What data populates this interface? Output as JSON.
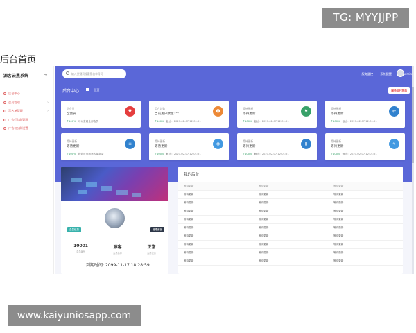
{
  "overlay": {
    "tg_badge": "TG: MYYJJPP",
    "page_caption": "后台首页",
    "url_badge": "www.kaiyuniosapp.com"
  },
  "sidebar": {
    "brand": "源客云黑系统",
    "items": [
      {
        "label": "后台中心",
        "has_arrow": false
      },
      {
        "label": "会员管理",
        "has_arrow": true
      },
      {
        "label": "黑名单管理",
        "has_arrow": true
      },
      {
        "label": "广告(顶部)管理",
        "has_arrow": false
      },
      {
        "label": "广告(底部)设置",
        "has_arrow": false
      }
    ]
  },
  "topbar": {
    "search_placeholder": "输入关键词搜索黑名单号码",
    "links": [
      "服务监控",
      "系统配置"
    ],
    "user_name": "admin"
  },
  "breadcrumb": {
    "title": "后台中心",
    "home": "首页"
  },
  "red_button": "服务运行状态",
  "cards": [
    {
      "label": "总会员",
      "value": "全会员",
      "up": "↑100%",
      "foot": "可以查看全部会员",
      "icon": "heart-icon",
      "glyph": "♥",
      "color": "#e53e3e"
    },
    {
      "label": "用户总数",
      "value": "当前用户数量1个",
      "up": "↑100%",
      "foot": "截止：2021-02-07 12:01:51",
      "icon": "user-icon",
      "glyph": "☻",
      "color": "#ed8936"
    },
    {
      "label": "等待更新",
      "value": "等待更新",
      "up": "↑100%",
      "foot": "截止：2021-02-07 12:01:51",
      "icon": "flag-icon",
      "glyph": "⚑",
      "color": "#38a169"
    },
    {
      "label": "等待更新",
      "value": "等待更新",
      "up": "↑100%",
      "foot": "截止：2021-02-07 12:01:51",
      "icon": "link-icon",
      "glyph": "⇄",
      "color": "#3182ce"
    },
    {
      "label": "等待更新",
      "value": "等待更新",
      "up": "↑100%",
      "foot": "此处可查看黑名单数量",
      "icon": "list-icon",
      "glyph": "≡",
      "color": "#3182ce"
    },
    {
      "label": "等待更新",
      "value": "等待更新",
      "up": "↑100%",
      "foot": "截止：2021-02-07 12:01:51",
      "icon": "compass-icon",
      "glyph": "◉",
      "color": "#4299e1"
    },
    {
      "label": "等待更新",
      "value": "等待更新",
      "up": "↑100%",
      "foot": "截止：2021-02-07 12:01:51",
      "icon": "bar-chart-icon",
      "glyph": "▮",
      "color": "#3182ce"
    },
    {
      "label": "等待更新",
      "value": "等待更新",
      "up": "↑100%",
      "foot": "截止：2021-02-07 12:01:51",
      "icon": "pulse-icon",
      "glyph": "∿",
      "color": "#4299e1"
    }
  ],
  "profile": {
    "tag_left": "会员信息",
    "tag_right": "管理面板",
    "stats": [
      {
        "value": "10001",
        "label": "会员编号"
      },
      {
        "value": "源客",
        "label": "会员名称"
      },
      {
        "value": "正常",
        "label": "会员状态"
      }
    ],
    "login_label": "到期时间:",
    "login_value": "2099-11-17 18:28:59"
  },
  "panel": {
    "title": "我的后台",
    "headers": [
      "等待更新",
      "等待更新",
      "等待更新"
    ],
    "rows": [
      [
        "等待更新",
        "等待更新",
        "等待更新"
      ],
      [
        "等待更新",
        "等待更新",
        "等待更新"
      ],
      [
        "等待更新",
        "等待更新",
        "等待更新"
      ],
      [
        "等待更新",
        "等待更新",
        "等待更新"
      ],
      [
        "等待更新",
        "等待更新",
        "等待更新"
      ],
      [
        "等待更新",
        "等待更新",
        "等待更新"
      ],
      [
        "等待更新",
        "等待更新",
        "等待更新"
      ],
      [
        "等待更新",
        "等待更新",
        "等待更新"
      ],
      [
        "等待更新",
        "等待更新",
        "等待更新"
      ]
    ]
  },
  "colors": {
    "banner": "#5a67d8",
    "accent_red": "#e53e3e",
    "positive": "#38a169"
  }
}
